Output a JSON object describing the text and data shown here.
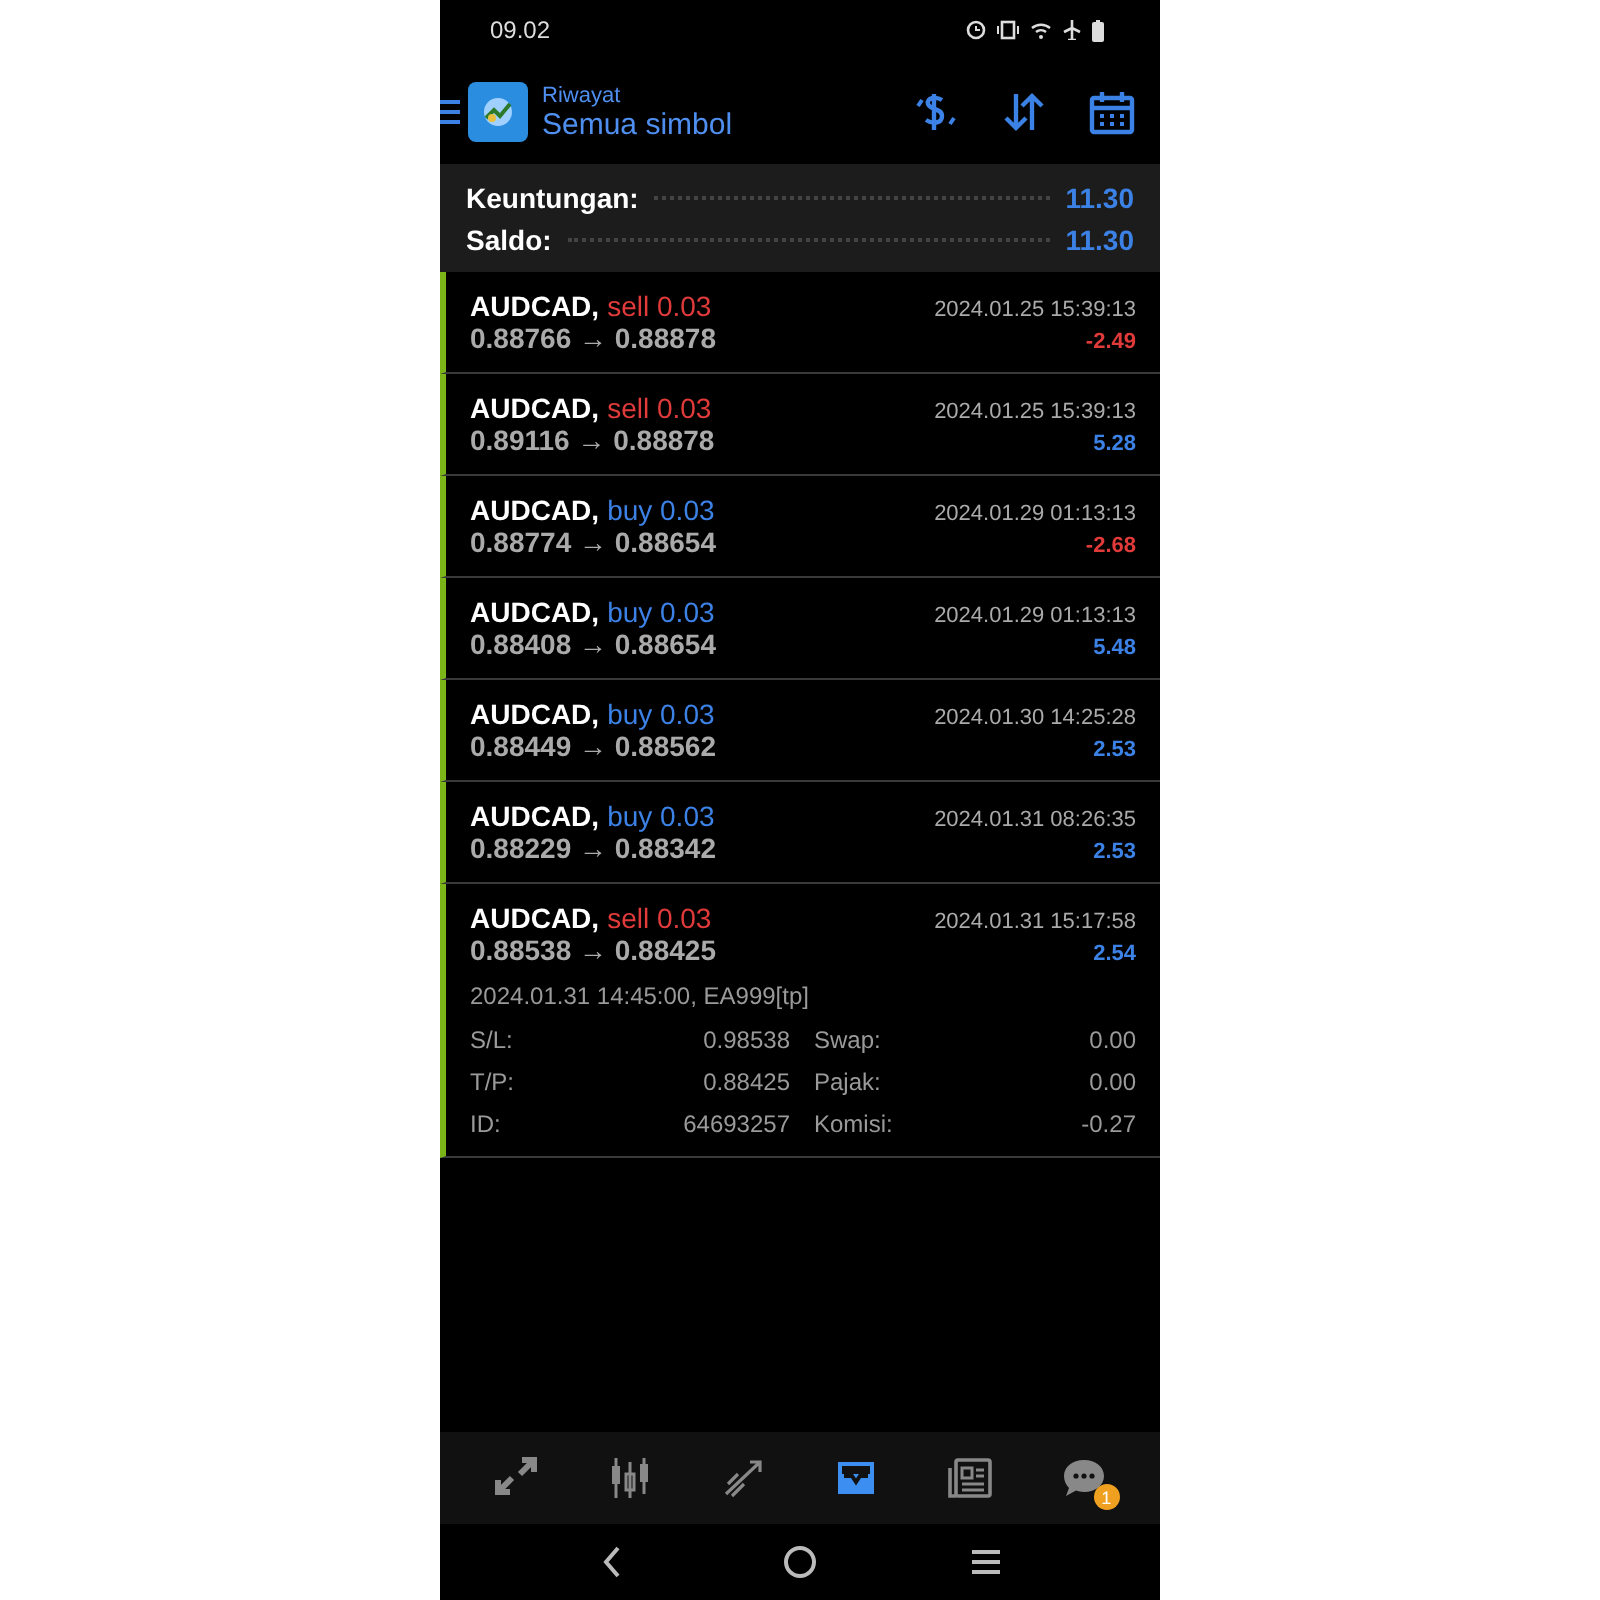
{
  "status_bar": {
    "time": "09.02"
  },
  "header": {
    "subtitle": "Riwayat",
    "title": "Semua simbol"
  },
  "summary": [
    {
      "label": "Keuntungan:",
      "value": "11.30"
    },
    {
      "label": "Saldo:",
      "value": "11.30"
    }
  ],
  "deals": [
    {
      "symbol": "AUDCAD,",
      "order": {
        "text": "sell 0.03",
        "color": "#e03a3a"
      },
      "prices": "0.88766 → 0.88878",
      "time": "2024.01.25 15:39:13",
      "profit": {
        "text": "-2.49",
        "color": "#e03a3a"
      }
    },
    {
      "symbol": "AUDCAD,",
      "order": {
        "text": "sell 0.03",
        "color": "#e03a3a"
      },
      "prices": "0.89116 → 0.88878",
      "time": "2024.01.25 15:39:13",
      "profit": {
        "text": "5.28",
        "color": "#3c82e6"
      }
    },
    {
      "symbol": "AUDCAD,",
      "order": {
        "text": "buy 0.03",
        "color": "#3c82e6"
      },
      "prices": "0.88774 → 0.88654",
      "time": "2024.01.29 01:13:13",
      "profit": {
        "text": "-2.68",
        "color": "#e03a3a"
      }
    },
    {
      "symbol": "AUDCAD,",
      "order": {
        "text": "buy 0.03",
        "color": "#3c82e6"
      },
      "prices": "0.88408 → 0.88654",
      "time": "2024.01.29 01:13:13",
      "profit": {
        "text": "5.48",
        "color": "#3c82e6"
      }
    },
    {
      "symbol": "AUDCAD,",
      "order": {
        "text": "buy 0.03",
        "color": "#3c82e6"
      },
      "prices": "0.88449 → 0.88562",
      "time": "2024.01.30 14:25:28",
      "profit": {
        "text": "2.53",
        "color": "#3c82e6"
      }
    },
    {
      "symbol": "AUDCAD,",
      "order": {
        "text": "buy 0.03",
        "color": "#3c82e6"
      },
      "prices": "0.88229 → 0.88342",
      "time": "2024.01.31 08:26:35",
      "profit": {
        "text": "2.53",
        "color": "#3c82e6"
      }
    },
    {
      "symbol": "AUDCAD,",
      "order": {
        "text": "sell 0.03",
        "color": "#e03a3a"
      },
      "prices": "0.88538 → 0.88425",
      "time": "2024.01.31 15:17:58",
      "profit": {
        "text": "2.54",
        "color": "#3c82e6"
      },
      "details": {
        "opened": "2024.01.31 14:45:00, EA999[tp]",
        "fields": [
          {
            "label": "S/L:",
            "value": "0.98538"
          },
          {
            "label": "Swap:",
            "value": "0.00"
          },
          {
            "label": "T/P:",
            "value": "0.88425"
          },
          {
            "label": "Pajak:",
            "value": "0.00"
          },
          {
            "label": "ID:",
            "value": "64693257"
          },
          {
            "label": "Komisi:",
            "value": "-0.27"
          }
        ]
      }
    }
  ],
  "tab_bar": [
    {
      "kind": "trade",
      "selected": false
    },
    {
      "kind": "quotes",
      "selected": false
    },
    {
      "kind": "chart",
      "selected": false
    },
    {
      "kind": "history",
      "selected": true
    },
    {
      "kind": "news",
      "selected": false
    },
    {
      "kind": "chat",
      "selected": false,
      "badge": "1"
    }
  ]
}
